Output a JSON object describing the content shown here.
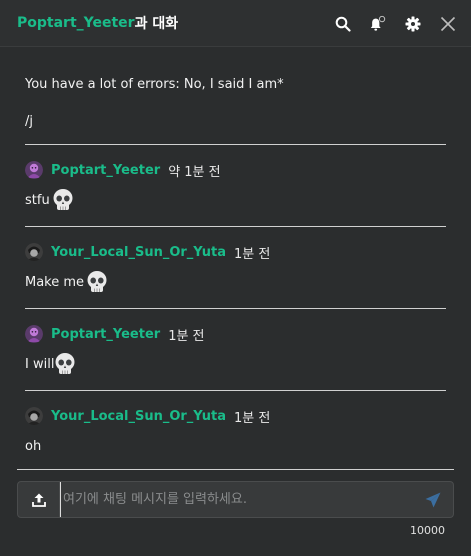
{
  "header": {
    "username": "Poptart_Yeeter",
    "suffix": "과 대화"
  },
  "messages": {
    "continued_lines": [
      "You have a lot of errors: No, I said I am*",
      "/j"
    ],
    "items": [
      {
        "username": "Poptart_Yeeter",
        "time": "약 1분 전",
        "text": "stfu",
        "avatar": "pink-character-avatar"
      },
      {
        "username": "Your_Local_Sun_Or_Yuta",
        "time": "1분 전",
        "text": "Make me",
        "avatar": "dark-character-avatar"
      },
      {
        "username": "Poptart_Yeeter",
        "time": "1분 전",
        "text": "I will",
        "avatar": "pink-character-avatar"
      },
      {
        "username": "Your_Local_Sun_Or_Yuta",
        "time": "1분 전",
        "text": "oh",
        "avatar": "dark-character-avatar"
      }
    ]
  },
  "composer": {
    "placeholder": "여기에 채팅 메시지를 입력하세요.",
    "value": "",
    "char_limit": "10000"
  },
  "colors": {
    "accent": "#1abc8a",
    "send": "#3b6ea0",
    "background": "#2b2d2e"
  },
  "icons": [
    "search-icon",
    "bell-icon",
    "gear-icon",
    "close-icon",
    "upload-icon",
    "send-icon",
    "skull-emoji"
  ]
}
